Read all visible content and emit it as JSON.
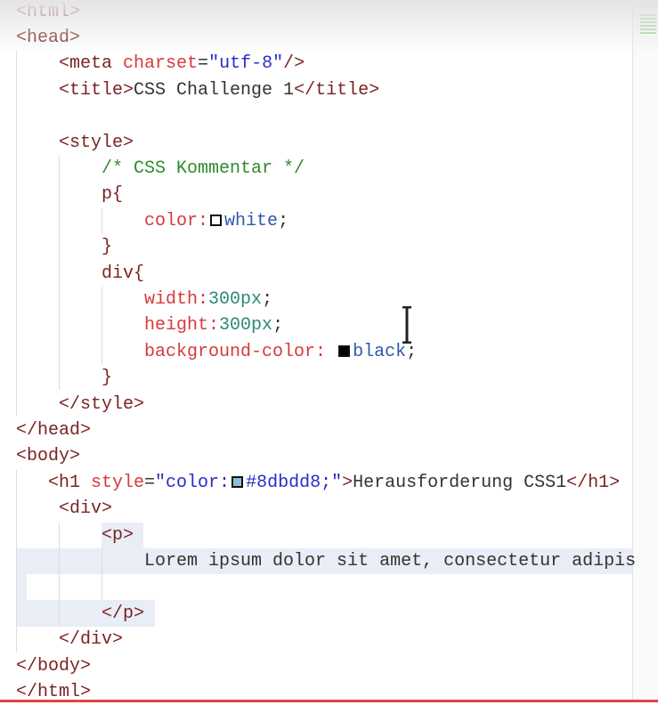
{
  "editor": {
    "lines": [
      [
        {
          "t": "<html>",
          "c": "tag"
        }
      ],
      [
        {
          "t": "<head>",
          "c": "tag"
        }
      ],
      [
        {
          "t": "    <meta ",
          "c": "tag"
        },
        {
          "t": "charset",
          "c": "attr"
        },
        {
          "t": "=",
          "c": "txt"
        },
        {
          "t": "\"utf-8\"",
          "c": "str"
        },
        {
          "t": "/>",
          "c": "tag"
        }
      ],
      [
        {
          "t": "    <title>",
          "c": "tag"
        },
        {
          "t": "CSS Challenge 1",
          "c": "txt"
        },
        {
          "t": "</title>",
          "c": "tag"
        }
      ],
      [],
      [
        {
          "t": "    <style>",
          "c": "tag"
        }
      ],
      [
        {
          "t": "        /* CSS Kommentar */",
          "c": "cmt"
        }
      ],
      [
        {
          "t": "        p{",
          "c": "tag"
        }
      ],
      [
        {
          "t": "            color:",
          "c": "prop"
        },
        {
          "sw": "#ffffff"
        },
        {
          "t": "white",
          "c": "val"
        },
        {
          "t": ";",
          "c": "txt"
        }
      ],
      [
        {
          "t": "        }",
          "c": "tag"
        }
      ],
      [
        {
          "t": "        div{",
          "c": "tag"
        }
      ],
      [
        {
          "t": "            width:",
          "c": "prop"
        },
        {
          "t": "300px",
          "c": "num"
        },
        {
          "t": ";",
          "c": "txt"
        }
      ],
      [
        {
          "t": "            height:",
          "c": "prop"
        },
        {
          "t": "300px",
          "c": "num"
        },
        {
          "t": ";",
          "c": "txt"
        }
      ],
      [
        {
          "t": "            background-color: ",
          "c": "prop"
        },
        {
          "sw": "#000000"
        },
        {
          "t": "black",
          "c": "val"
        },
        {
          "t": ";",
          "c": "txt"
        }
      ],
      [
        {
          "t": "        }",
          "c": "tag"
        }
      ],
      [
        {
          "t": "    </style>",
          "c": "tag"
        }
      ],
      [
        {
          "t": "</head>",
          "c": "tag"
        }
      ],
      [
        {
          "t": "<body>",
          "c": "tag"
        }
      ],
      [
        {
          "t": "   <h1 ",
          "c": "tag"
        },
        {
          "t": "style",
          "c": "attr"
        },
        {
          "t": "=",
          "c": "txt"
        },
        {
          "t": "\"color:",
          "c": "str"
        },
        {
          "sw": "#8dbdd8"
        },
        {
          "t": "#8dbdd8;\"",
          "c": "str"
        },
        {
          "t": ">",
          "c": "tag"
        },
        {
          "t": "Herausforderung CSS1",
          "c": "txt"
        },
        {
          "t": "</h1>",
          "c": "tag"
        }
      ],
      [
        {
          "t": "    <div>",
          "c": "tag"
        }
      ],
      [
        {
          "t": "        <p>",
          "c": "tag"
        }
      ],
      [
        {
          "t": "            Lorem ipsum dolor sit amet, consectetur adipis",
          "c": "txt"
        }
      ],
      [],
      [
        {
          "t": "        </p>",
          "c": "tag"
        }
      ],
      [
        {
          "t": "    </div>",
          "c": "tag"
        }
      ],
      [
        {
          "t": "</body>",
          "c": "tag"
        }
      ],
      [
        {
          "t": "</html>",
          "c": "tag"
        }
      ]
    ]
  }
}
